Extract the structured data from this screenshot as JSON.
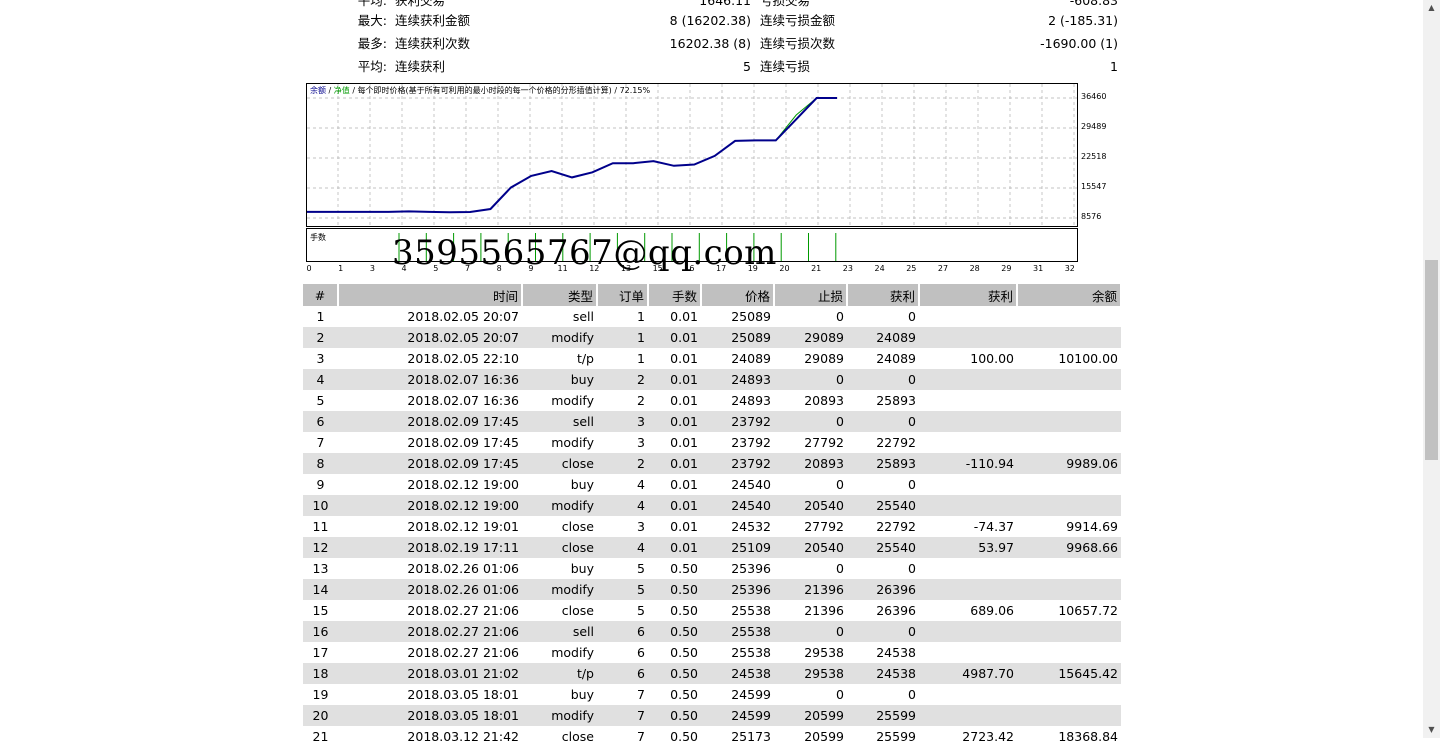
{
  "summary": [
    {
      "prefix": "平均:",
      "label": "获利交易",
      "value": "1646.11",
      "label2": "亏损交易",
      "value2": "-608.83"
    },
    {
      "prefix": "最大:",
      "label": "连续获利金额",
      "value": "8 (16202.38)",
      "label2": "连续亏损金额",
      "value2": "2 (-185.31)"
    },
    {
      "prefix": "最多:",
      "label": "连续获利次数",
      "value": "16202.38 (8)",
      "label2": "连续亏损次数",
      "value2": "-1690.00 (1)"
    },
    {
      "prefix": "平均:",
      "label": "连续获利",
      "value": "5",
      "label2": "连续亏损",
      "value2": "1"
    }
  ],
  "chart": {
    "title_balance": "余额",
    "title_sep1": " / ",
    "title_equity": "净值",
    "title_rest": " / 每个即时价格(基于所有可利用的最小时段的每一个价格的分形插值计算) / 72.15%",
    "lot_label": "手数",
    "colors": {
      "balance": "#00008b",
      "equity": "#009900",
      "grid": "#b0b0b0"
    }
  },
  "chart_data": {
    "type": "line",
    "ylim": [
      8576,
      36460
    ],
    "yticks": [
      "36460",
      "29489",
      "22518",
      "15547",
      "8576"
    ],
    "xticks": [
      "0",
      "1",
      "3",
      "4",
      "5",
      "7",
      "8",
      "9",
      "11",
      "12",
      "13",
      "15",
      "16",
      "17",
      "19",
      "20",
      "21",
      "23",
      "24",
      "25",
      "27",
      "28",
      "29",
      "31",
      "32"
    ],
    "series": [
      {
        "name": "余额",
        "values": [
          10000,
          10000,
          10000,
          10000,
          10000,
          10100,
          9989,
          9915,
          9969,
          10658,
          15645,
          18369,
          19500,
          18000,
          19200,
          21300,
          21300,
          21800,
          20700,
          21000,
          23000,
          26500,
          26600,
          26600,
          31500,
          36460,
          36460
        ]
      },
      {
        "name": "净值",
        "values": [
          10000,
          10000,
          10000,
          10000,
          10000,
          10100,
          9989,
          9915,
          9969,
          10658,
          15645,
          18369,
          19500,
          18000,
          19200,
          21300,
          21300,
          21800,
          20700,
          21000,
          23000,
          26500,
          26600,
          26600,
          32500,
          36460,
          36460
        ]
      }
    ]
  },
  "watermark": "3595565767@qq.com",
  "table": {
    "headers": [
      "#",
      "时间",
      "类型",
      "订单",
      "手数",
      "价格",
      "止损",
      "获利",
      "获利",
      "余额"
    ],
    "rows": [
      [
        "1",
        "2018.02.05 20:07",
        "sell",
        "1",
        "0.01",
        "25089",
        "0",
        "0",
        "",
        ""
      ],
      [
        "2",
        "2018.02.05 20:07",
        "modify",
        "1",
        "0.01",
        "25089",
        "29089",
        "24089",
        "",
        ""
      ],
      [
        "3",
        "2018.02.05 22:10",
        "t/p",
        "1",
        "0.01",
        "24089",
        "29089",
        "24089",
        "100.00",
        "10100.00"
      ],
      [
        "4",
        "2018.02.07 16:36",
        "buy",
        "2",
        "0.01",
        "24893",
        "0",
        "0",
        "",
        ""
      ],
      [
        "5",
        "2018.02.07 16:36",
        "modify",
        "2",
        "0.01",
        "24893",
        "20893",
        "25893",
        "",
        ""
      ],
      [
        "6",
        "2018.02.09 17:45",
        "sell",
        "3",
        "0.01",
        "23792",
        "0",
        "0",
        "",
        ""
      ],
      [
        "7",
        "2018.02.09 17:45",
        "modify",
        "3",
        "0.01",
        "23792",
        "27792",
        "22792",
        "",
        ""
      ],
      [
        "8",
        "2018.02.09 17:45",
        "close",
        "2",
        "0.01",
        "23792",
        "20893",
        "25893",
        "-110.94",
        "9989.06"
      ],
      [
        "9",
        "2018.02.12 19:00",
        "buy",
        "4",
        "0.01",
        "24540",
        "0",
        "0",
        "",
        ""
      ],
      [
        "10",
        "2018.02.12 19:00",
        "modify",
        "4",
        "0.01",
        "24540",
        "20540",
        "25540",
        "",
        ""
      ],
      [
        "11",
        "2018.02.12 19:01",
        "close",
        "3",
        "0.01",
        "24532",
        "27792",
        "22792",
        "-74.37",
        "9914.69"
      ],
      [
        "12",
        "2018.02.19 17:11",
        "close",
        "4",
        "0.01",
        "25109",
        "20540",
        "25540",
        "53.97",
        "9968.66"
      ],
      [
        "13",
        "2018.02.26 01:06",
        "buy",
        "5",
        "0.50",
        "25396",
        "0",
        "0",
        "",
        ""
      ],
      [
        "14",
        "2018.02.26 01:06",
        "modify",
        "5",
        "0.50",
        "25396",
        "21396",
        "26396",
        "",
        ""
      ],
      [
        "15",
        "2018.02.27 21:06",
        "close",
        "5",
        "0.50",
        "25538",
        "21396",
        "26396",
        "689.06",
        "10657.72"
      ],
      [
        "16",
        "2018.02.27 21:06",
        "sell",
        "6",
        "0.50",
        "25538",
        "0",
        "0",
        "",
        ""
      ],
      [
        "17",
        "2018.02.27 21:06",
        "modify",
        "6",
        "0.50",
        "25538",
        "29538",
        "24538",
        "",
        ""
      ],
      [
        "18",
        "2018.03.01 21:02",
        "t/p",
        "6",
        "0.50",
        "24538",
        "29538",
        "24538",
        "4987.70",
        "15645.42"
      ],
      [
        "19",
        "2018.03.05 18:01",
        "buy",
        "7",
        "0.50",
        "24599",
        "0",
        "0",
        "",
        ""
      ],
      [
        "20",
        "2018.03.05 18:01",
        "modify",
        "7",
        "0.50",
        "24599",
        "20599",
        "25599",
        "",
        ""
      ],
      [
        "21",
        "2018.03.12 21:42",
        "close",
        "7",
        "0.50",
        "25173",
        "20599",
        "25599",
        "2723.42",
        "18368.84"
      ]
    ]
  },
  "scrollbar": {
    "up_icon": "▲",
    "down_icon": "▼"
  }
}
